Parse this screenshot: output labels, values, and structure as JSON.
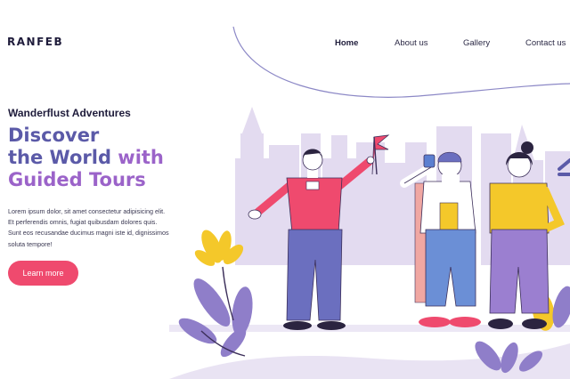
{
  "brand": {
    "name": "RANFEB"
  },
  "nav": {
    "items": [
      {
        "label": "Home",
        "active": true
      },
      {
        "label": "About us",
        "active": false
      },
      {
        "label": "Gallery",
        "active": false
      },
      {
        "label": "Contact us",
        "active": false
      }
    ]
  },
  "hero": {
    "eyebrow": "Wanderflust Adventures",
    "headline": {
      "line1": "Discover",
      "line2a": "the World ",
      "line2b": "with",
      "line3": "Guided Tours"
    },
    "paragraph": {
      "line1": "Lorem ipsum dolor, sit amet consectetur adipisicing elit.",
      "line2": "Et perferendis omnis, fugiat quibusdam dolores quis.",
      "line3": "Sunt eos recusandae ducimus magni iste id, dignissimos",
      "line4": "soluta tempore!"
    },
    "cta_label": "Learn more"
  },
  "theme": {
    "primary": "#5b5aa8",
    "accent_purple": "#9b63c9",
    "cta_pink": "#ef4a6e",
    "skyline_lavender": "#e3dbf0",
    "dark_text": "#1f1c3b"
  }
}
